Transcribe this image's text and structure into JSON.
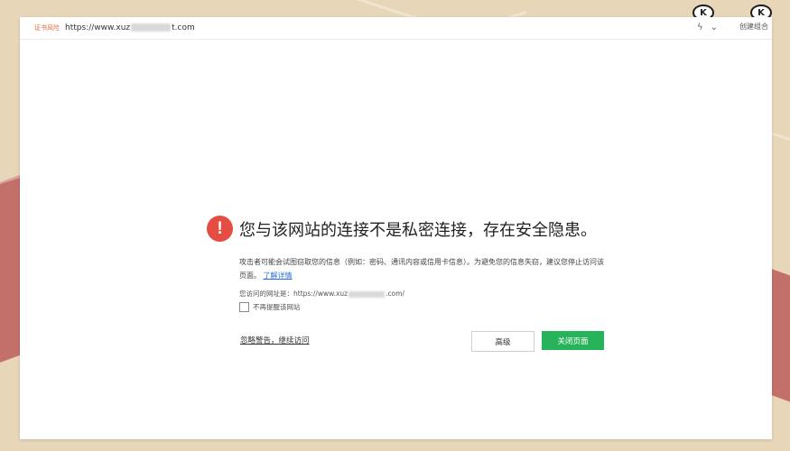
{
  "browser": {
    "unsafe_label": "证书风险",
    "url_prefix": "https://www.xuz",
    "url_suffix": "t.com"
  },
  "warning": {
    "title": "您与该网站的连接不是私密连接，存在安全隐患。",
    "description": "攻击者可能会试图窃取您的信息（例如：密码、通讯内容或信用卡信息）。为避免您的信息失窃，建议您停止访问该页面。",
    "learn_more": "了解详情",
    "visited_label": "您访问的网址是：https://www.xuz",
    "visited_suffix": ".com/",
    "checkbox_label": "不再提醒该网站",
    "ignore_link": "忽略警告，继续访问",
    "advanced_button": "高级",
    "close_button": "关闭页面"
  },
  "corner": {
    "badge_1": "K",
    "badge_2": "K",
    "label": "创建组合"
  },
  "colors": {
    "warning_red": "#e54d42",
    "close_green": "#27b35a",
    "link_blue": "#2b6fd6"
  }
}
